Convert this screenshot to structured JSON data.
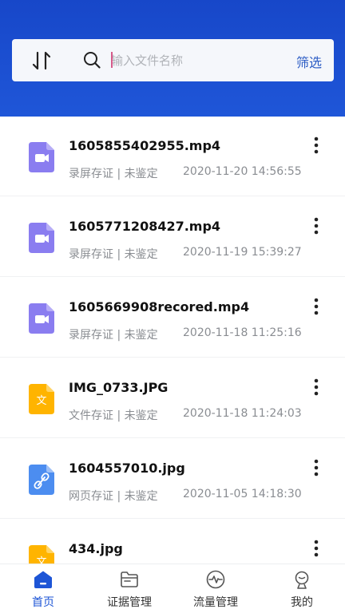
{
  "colors": {
    "header_bg": "#1d4fd2",
    "accent": "#1d55d6",
    "video_icon": "#8a7df0",
    "image_icon": "#ffb400",
    "link_icon": "#4c8df0"
  },
  "search": {
    "placeholder": "输入文件名称",
    "filter_label": "筛选"
  },
  "files": [
    {
      "name": "1605855402955.mp4",
      "category": "录屏存证 | 未鉴定",
      "time": "2020-11-20 14:56:55",
      "icon": "video-file-icon"
    },
    {
      "name": "1605771208427.mp4",
      "category": "录屏存证 | 未鉴定",
      "time": "2020-11-19 15:39:27",
      "icon": "video-file-icon"
    },
    {
      "name": "1605669908recored.mp4",
      "category": "录屏存证 | 未鉴定",
      "time": "2020-11-18 11:25:16",
      "icon": "video-file-icon"
    },
    {
      "name": "IMG_0733.JPG",
      "category": "文件存证 | 未鉴定",
      "time": "2020-11-18 11:24:03",
      "icon": "document-file-icon",
      "glyph": "文"
    },
    {
      "name": "1604557010.jpg",
      "category": "网页存证 | 未鉴定",
      "time": "2020-11-05 14:18:30",
      "icon": "link-file-icon"
    },
    {
      "name": "434.jpg",
      "category": "",
      "time": "",
      "icon": "document-file-icon",
      "glyph": "文"
    }
  ],
  "tabs": [
    {
      "label": "首页",
      "icon": "home-icon",
      "active": true
    },
    {
      "label": "证据管理",
      "icon": "folder-icon",
      "active": false
    },
    {
      "label": "流量管理",
      "icon": "pulse-icon",
      "active": false
    },
    {
      "label": "我的",
      "icon": "profile-icon",
      "active": false
    }
  ]
}
